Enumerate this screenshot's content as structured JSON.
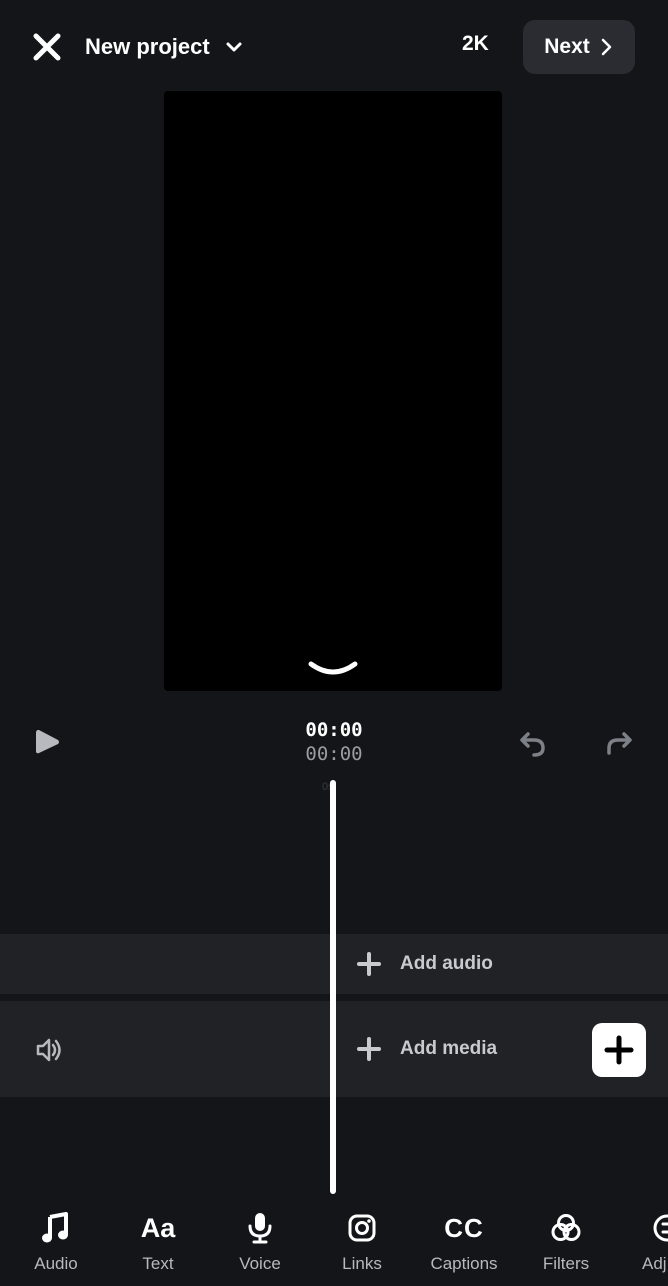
{
  "header": {
    "title": "New project",
    "resolution": "2K",
    "next_label": "Next"
  },
  "playback": {
    "current_time": "00:00",
    "total_time": "00:00",
    "tick_label": "0s"
  },
  "tracks": {
    "add_audio_label": "Add audio",
    "add_media_label": "Add media"
  },
  "toolbar": {
    "items": [
      {
        "label": "Audio",
        "icon": "music-note-icon"
      },
      {
        "label": "Text",
        "icon": "text-aa-icon",
        "glyph": "Aa"
      },
      {
        "label": "Voice",
        "icon": "microphone-icon"
      },
      {
        "label": "Links",
        "icon": "instagram-icon"
      },
      {
        "label": "Captions",
        "icon": "captions-cc-icon",
        "glyph": "CC"
      },
      {
        "label": "Filters",
        "icon": "filters-icon"
      },
      {
        "label": "Adj",
        "icon": "adjust-icon"
      }
    ]
  },
  "colors": {
    "background": "#141518",
    "track": "#212226",
    "button_bg": "#2a2c31",
    "muted_text": "#9a9ca3"
  }
}
